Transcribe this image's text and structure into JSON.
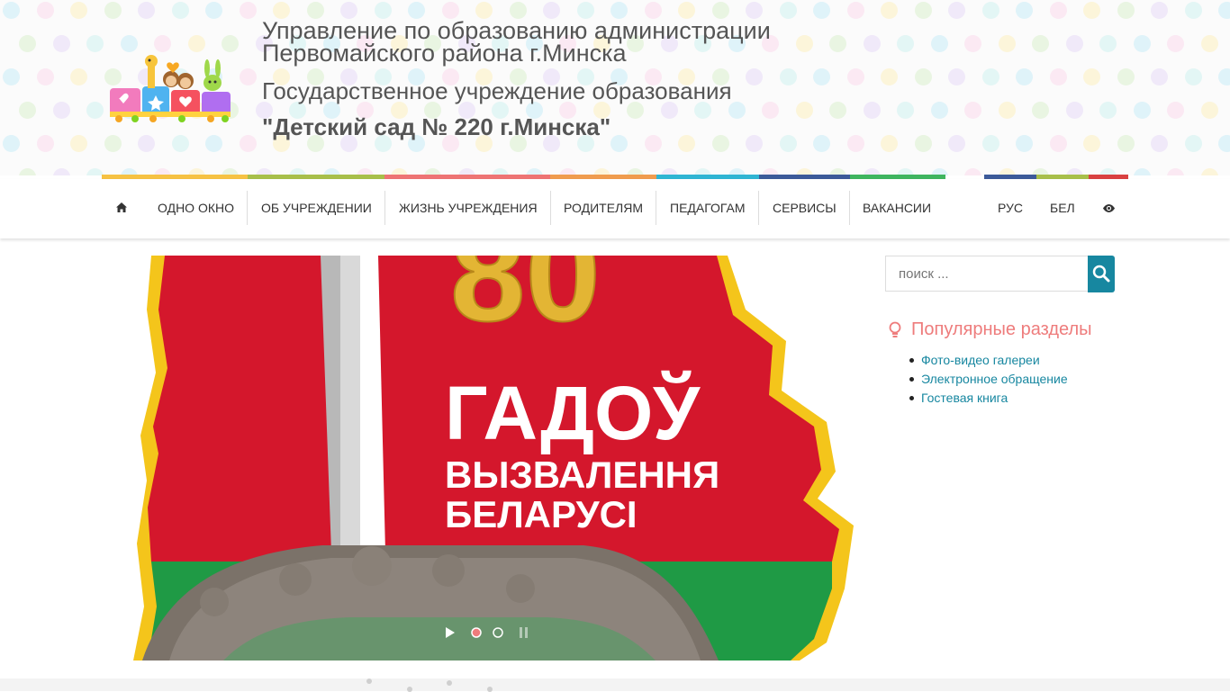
{
  "header": {
    "line1": "Управление по образованию администрации Первомайского района г.Минска",
    "line2": "Государственное учреждение образования",
    "line3": "\"Детский сад № 220 г.Минска\""
  },
  "nav": {
    "home_icon": "home-icon",
    "items": [
      "ОДНО ОКНО",
      "ОБ УЧРЕЖДЕНИИ",
      "ЖИЗНЬ УЧРЕЖДЕНИЯ",
      "РОДИТЕЛЯМ",
      "ПЕДАГОГАМ",
      "СЕРВИСЫ",
      "ВАКАНСИИ"
    ],
    "lang_ru": "РУС",
    "lang_by": "БЕЛ",
    "accessibility_icon": "eye-icon"
  },
  "slide": {
    "number": "80",
    "line1": "ГАДОЎ",
    "line2": "ВЫЗВАЛЕННЯ",
    "line3": "БЕЛАРУСІ",
    "slide_count": 2,
    "active_slide": 1
  },
  "search": {
    "placeholder": "поиск ...",
    "icon": "search-icon"
  },
  "popular": {
    "title": "Популярные разделы",
    "icon": "lightbulb-icon",
    "links": [
      "Фото-видео галереи",
      "Электронное обращение",
      "Гостевая книга"
    ]
  },
  "colors": {
    "accent": "#1787a0",
    "popular_title": "#ee7c7c",
    "strip": [
      "#f6c243",
      "#a8bf4a",
      "#ee7474",
      "#f09c4e",
      "#2fb5d3",
      "#3c5a99",
      "#3fb55f",
      "#3c5a99",
      "#a8bf4a",
      "#d94141"
    ]
  }
}
